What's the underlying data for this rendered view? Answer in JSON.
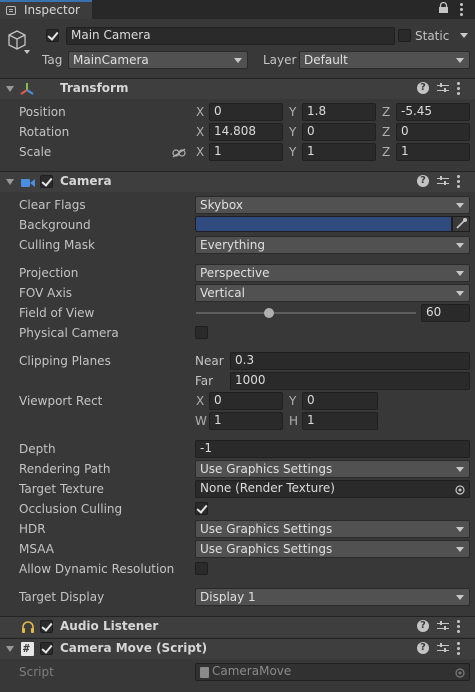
{
  "tab": {
    "title": "Inspector"
  },
  "header": {
    "name_value": "Main Camera",
    "static_label": "Static",
    "tag_label": "Tag",
    "tag_value": "MainCamera",
    "layer_label": "Layer",
    "layer_value": "Default"
  },
  "transform": {
    "title": "Transform",
    "rows": [
      {
        "label": "Position",
        "x": "0",
        "y": "1.8",
        "z": "-5.45"
      },
      {
        "label": "Rotation",
        "x": "14.808",
        "y": "0",
        "z": "0"
      },
      {
        "label": "Scale",
        "x": "1",
        "y": "1",
        "z": "1"
      }
    ],
    "axis": {
      "x": "X",
      "y": "Y",
      "z": "Z"
    }
  },
  "camera": {
    "title": "Camera",
    "clear_flags": {
      "label": "Clear Flags",
      "value": "Skybox"
    },
    "background": {
      "label": "Background",
      "color": "#2f4b80"
    },
    "culling_mask": {
      "label": "Culling Mask",
      "value": "Everything"
    },
    "projection": {
      "label": "Projection",
      "value": "Perspective"
    },
    "fov_axis": {
      "label": "FOV Axis",
      "value": "Vertical"
    },
    "field_of_view": {
      "label": "Field of View",
      "value": "60",
      "slider_fraction": 0.33
    },
    "physical_camera": {
      "label": "Physical Camera"
    },
    "clipping": {
      "label": "Clipping Planes",
      "near_label": "Near",
      "near": "0.3",
      "far_label": "Far",
      "far": "1000"
    },
    "viewport": {
      "label": "Viewport Rect",
      "x_label": "X",
      "x": "0",
      "y_label": "Y",
      "y": "0",
      "w_label": "W",
      "w": "1",
      "h_label": "H",
      "h": "1"
    },
    "depth": {
      "label": "Depth",
      "value": "-1"
    },
    "rendering_path": {
      "label": "Rendering Path",
      "value": "Use Graphics Settings"
    },
    "target_texture": {
      "label": "Target Texture",
      "value": "None (Render Texture)"
    },
    "occlusion_culling": {
      "label": "Occlusion Culling"
    },
    "hdr": {
      "label": "HDR",
      "value": "Use Graphics Settings"
    },
    "msaa": {
      "label": "MSAA",
      "value": "Use Graphics Settings"
    },
    "dynamic_resolution": {
      "label": "Allow Dynamic Resolution"
    },
    "target_display": {
      "label": "Target Display",
      "value": "Display 1"
    }
  },
  "audio_listener": {
    "title": "Audio Listener"
  },
  "camera_move": {
    "title": "Camera Move (Script)",
    "script_label": "Script",
    "script_value": "CameraMove"
  },
  "icons": [
    "inspector-icon",
    "lock-icon",
    "kebab-menu-icon",
    "gameobject-cube-icon",
    "transform-icon",
    "camera-icon",
    "headphones-icon",
    "script-icon",
    "help-icon",
    "preset-icon",
    "eyedropper-icon",
    "object-picker-icon",
    "constrain-scale-icon"
  ]
}
